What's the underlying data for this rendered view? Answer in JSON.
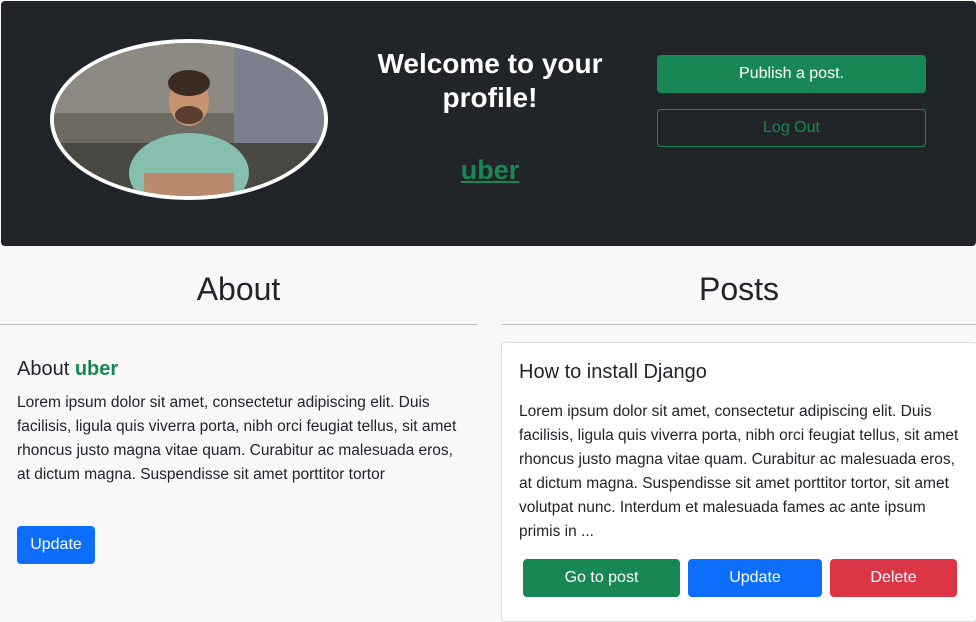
{
  "header": {
    "avatar_alt": "profile photo",
    "welcome": "Welcome to your profile!",
    "username": "uber",
    "publish_label": "Publish a post.",
    "logout_label": "Log Out"
  },
  "about": {
    "section_title": "About",
    "heading_prefix": "About ",
    "username": "uber",
    "text": "Lorem ipsum dolor sit amet, consectetur adipiscing elit. Duis facilisis, ligula quis viverra porta, nibh orci feugiat tellus, sit amet rhoncus justo magna vitae quam. Curabitur ac malesuada eros, at dictum magna. Suspendisse sit amet porttitor tortor",
    "update_label": "Update"
  },
  "posts": {
    "section_title": "Posts",
    "items": [
      {
        "title": "How to install Django",
        "excerpt": "Lorem ipsum dolor sit amet, consectetur adipiscing elit. Duis facilisis, ligula quis viverra porta, nibh orci feugiat tellus, sit amet rhoncus justo magna vitae quam. Curabitur ac malesuada eros, at dictum magna. Suspendisse sit amet porttitor tortor, sit amet volutpat nunc. Interdum et malesuada fames ac ante ipsum primis in ...",
        "goto_label": "Go to post",
        "update_label": "Update",
        "delete_label": "Delete"
      }
    ]
  },
  "colors": {
    "header_bg": "#212529",
    "success": "#198754",
    "primary": "#0d6efd",
    "danger": "#dc3545"
  }
}
